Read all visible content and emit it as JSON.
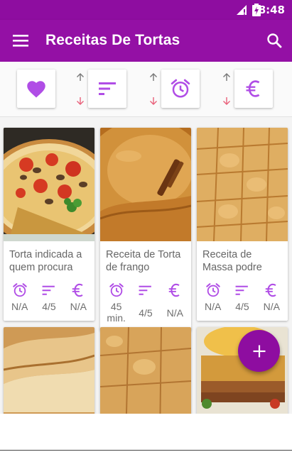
{
  "status_bar": {
    "time": "8:48"
  },
  "app_bar": {
    "title": "Receitas De Tortas"
  },
  "filters": [
    {
      "name": "favorites",
      "icon": "heart-icon"
    },
    {
      "name": "rating",
      "icon": "sort-icon"
    },
    {
      "name": "time",
      "icon": "alarm-icon"
    },
    {
      "name": "price",
      "icon": "euro-icon"
    }
  ],
  "recipes": [
    {
      "title": "Torta indicada a quem procura",
      "time": "N/A",
      "rating": "4/5",
      "price": "N/A"
    },
    {
      "title": "Receita de Torta de frango",
      "time": "45 min.",
      "rating": "4/5",
      "price": "N/A"
    },
    {
      "title": "Receita de Massa podre",
      "time": "N/A",
      "rating": "4/5",
      "price": "N/A"
    }
  ],
  "colors": {
    "primary": "#9410a5",
    "accent": "#b04de6",
    "arrow_down": "#e8607a"
  }
}
